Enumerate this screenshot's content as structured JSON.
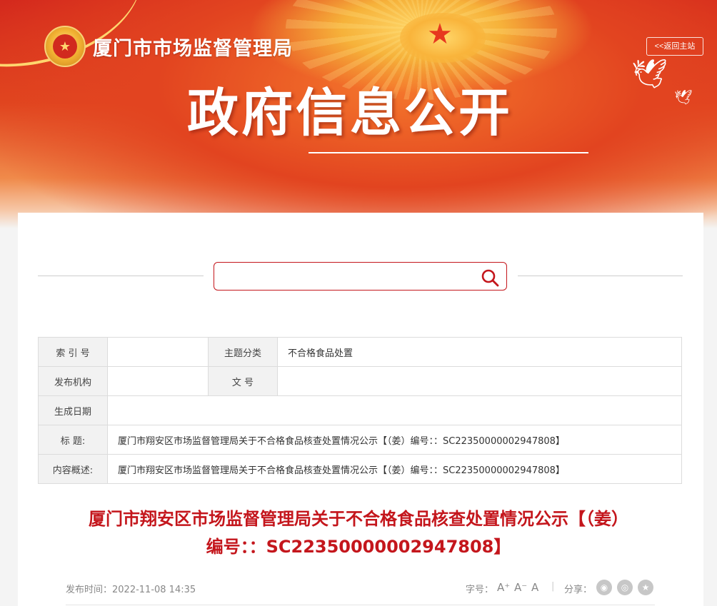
{
  "header": {
    "agency_name": "厦门市市场监督管理局",
    "back_home_label": "<<返回主站",
    "banner_title": "政府信息公开",
    "emblem_icon": "national-emblem-icon",
    "dove_icon": "dove-icon"
  },
  "search": {
    "placeholder": "",
    "value": "",
    "icon": "search-icon",
    "accent_color": "#c4161c"
  },
  "info_table": {
    "index_label": "索 引 号",
    "index_value": "",
    "category_label": "主题分类",
    "category_value": "不合格食品处置",
    "issuer_label": "发布机构",
    "issuer_value": "",
    "doc_no_label": "文 号",
    "doc_no_value": "",
    "date_label": "生成日期",
    "date_value": "",
    "title_label": "标 题:",
    "title_value": "厦门市翔安区市场监督管理局关于不合格食品核查处置情况公示【（姜）编号：：SC22350000002947808】",
    "summary_label": "内容概述:",
    "summary_value": "厦门市翔安区市场监督管理局关于不合格食品核查处置情况公示【（姜）编号：：SC22350000002947808】"
  },
  "article": {
    "title_line1": "厦门市翔安区市场监督管理局关于不合格食品核查处置情况公示【（姜）",
    "title_line2": "编号：：SC22350000002947808】",
    "title_color": "#c4161c",
    "publish_time": "发布时间：2022-11-08 14:35",
    "font_size_label": "字号：",
    "font_size_options": [
      "A⁺",
      "A⁻",
      "A"
    ],
    "separator": "|",
    "share_label": "分享：",
    "share_icons": [
      "wechat-icon",
      "weibo-icon",
      "favorite-icon"
    ]
  }
}
